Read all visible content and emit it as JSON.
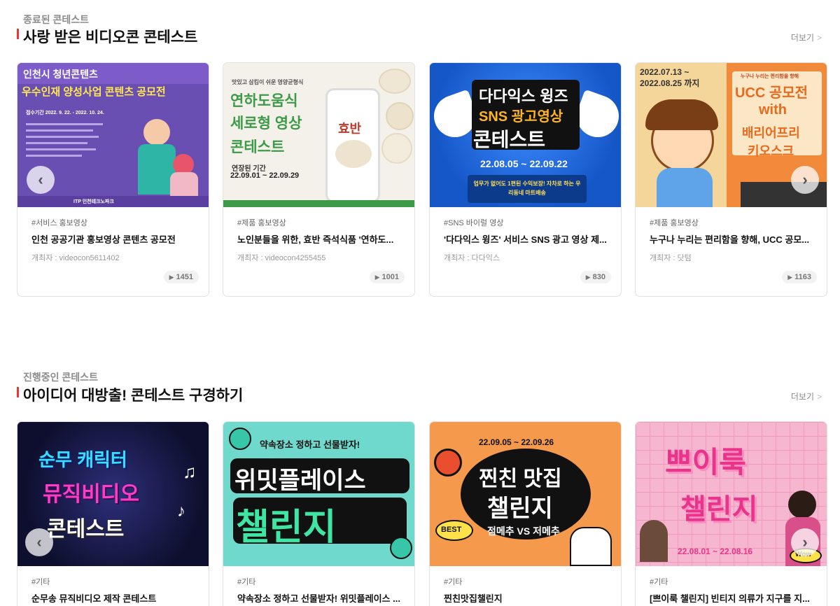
{
  "section1": {
    "subtitle": "종료된 콘테스트",
    "title": "사랑 받은 비디오콘 콘테스트",
    "more": "더보기",
    "cards": [
      {
        "thumb": {
          "line1": "인천시 청년콘텐츠",
          "line2": "우수인재 양성사업 콘텐츠 공모전",
          "line3": "접수기간 2022. 9. 22. - 2022. 10. 24.",
          "footer": "ITP 인천테크노파크"
        },
        "category": "#서비스 홍보영상",
        "title": "인천 공공기관 홍보영상 콘텐츠 공모전",
        "host": "개최자 : videocon5611402",
        "views": "1451"
      },
      {
        "thumb": {
          "top": "맛있고 삼킴이 쉬운 영양균형식",
          "line1": "연하도움식",
          "line2": "세로형 영상",
          "line3": "콘테스트",
          "period_label": "연장된 기간",
          "period": "22.09.01 ~ 22.09.29",
          "brand": "효반"
        },
        "category": "#제품 홍보영상",
        "title": "노인분들을 위한, 효반 즉석식품 '연하도...",
        "host": "개최자 : videocon4255455",
        "views": "1001"
      },
      {
        "thumb": {
          "line1": "다다익스 윙즈",
          "line2": "SNS 광고영상",
          "line3": "콘테스트",
          "period": "22.08.05 ~ 22.09.22",
          "footer": "업무가 없어도 1편된 수익보장! 자차로 하는 우리동네 마트배송"
        },
        "category": "#SNS 바이럴 영상",
        "title": "'다다익스 윙즈' 서비스 SNS 광고 영상 제...",
        "host": "개최자 : 다다익스",
        "views": "830"
      },
      {
        "thumb": {
          "period1": "2022.07.13 ~",
          "period2": "2022.08.25 까지",
          "top": "누구나 누리는 편리함을 향해",
          "line1": "UCC 공모전",
          "line2": "with",
          "line3": "배리어프리",
          "line4": "키오스크"
        },
        "category": "#제품 홍보영상",
        "title": "누구나 누리는 편리함을 향해, UCC 공모...",
        "host": "개최자 : 닷텀",
        "views": "1163"
      }
    ]
  },
  "section2": {
    "subtitle": "진행중인 콘테스트",
    "title": "아이디어 대방출! 콘테스트 구경하기",
    "more": "더보기",
    "cards": [
      {
        "thumb": {
          "line1": "순무 캐릭터",
          "line2": "뮤직비디오",
          "line3": "콘테스트"
        },
        "category": "#기타",
        "title": "순무송 뮤직비디오 제작 콘테스트"
      },
      {
        "thumb": {
          "top": "약속장소 정하고 선물받자!",
          "line1": "위밋플레이스",
          "line2": "챌린지"
        },
        "category": "#기타",
        "title": "약속장소 정하고 선물받자! 위밋플레이스 ..."
      },
      {
        "thumb": {
          "period": "22.09.05 ~ 22.09.26",
          "line1": "찐친 맛집",
          "line2": "챌린지",
          "badge": "BEST",
          "line3": "점메추 VS 저메추"
        },
        "category": "#기타",
        "title": "찐친맛집챌린지"
      },
      {
        "thumb": {
          "line1": "쁘이룩",
          "line2": "챌린지",
          "period": "22.08.01 ~ 22.08.16",
          "sticker": "Wow"
        },
        "category": "#기타",
        "title": "[쁘이룩 챌린지] 빈티지 의류가 지구를 지..."
      }
    ]
  },
  "icons": {
    "prev": "chevron-left-icon",
    "next": "chevron-right-icon",
    "play": "play-icon",
    "more": "chevron-right-small-icon"
  }
}
